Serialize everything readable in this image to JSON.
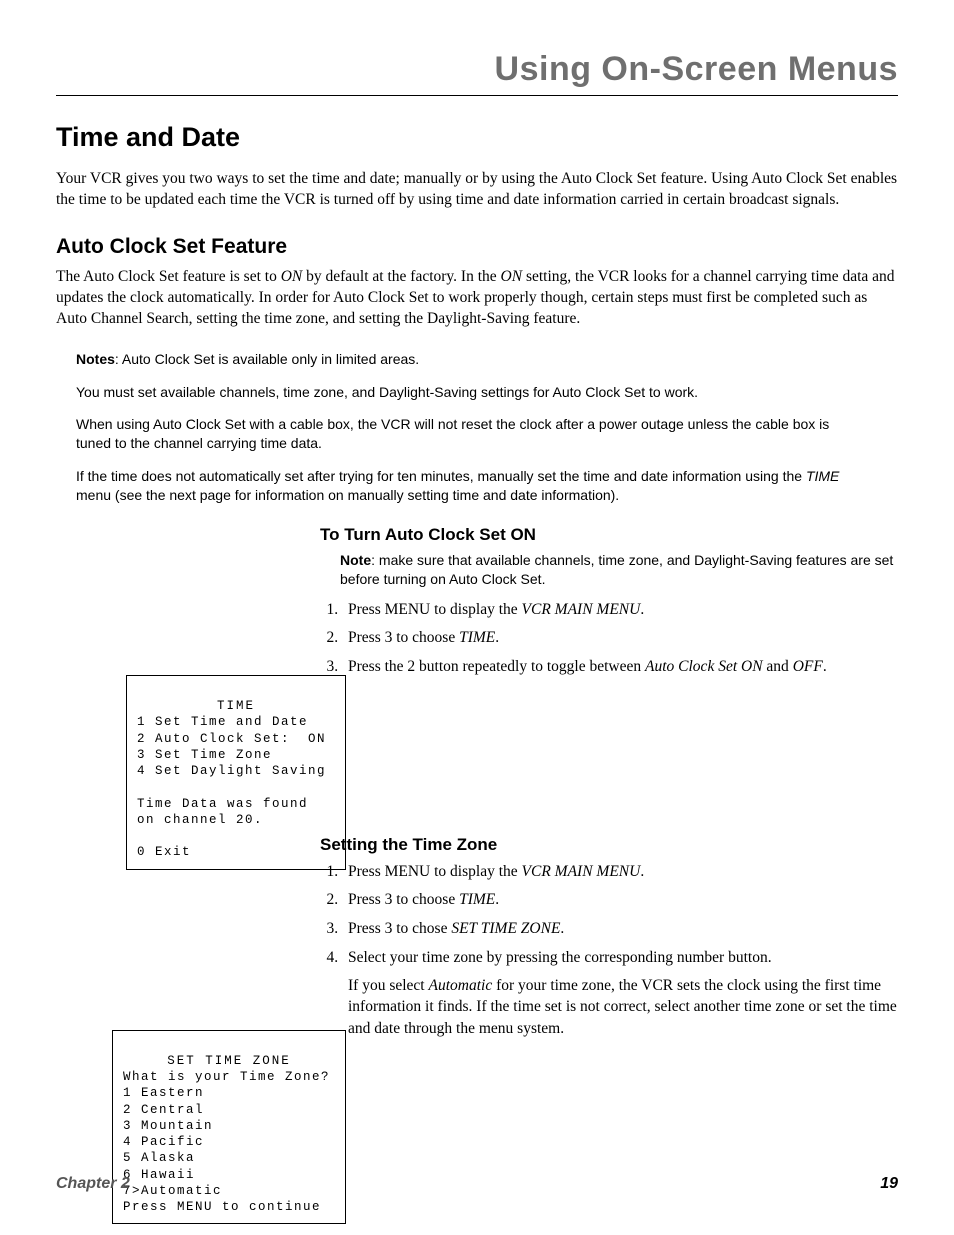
{
  "header": "Using On-Screen Menus",
  "h1": "Time and Date",
  "intro": "Your VCR gives you two ways to set the time and date; manually or by using the Auto Clock Set feature. Using Auto Clock Set enables the time to be updated each time the VCR is turned off by using time and date information carried in certain broadcast signals.",
  "h2": "Auto Clock Set Feature",
  "p_auto_pre": "The Auto Clock Set feature is set to ",
  "p_auto_on1": "ON",
  "p_auto_mid": " by default at the factory. In the ",
  "p_auto_on2": "ON",
  "p_auto_post": " setting, the VCR looks for a channel carrying time data and updates the clock automatically. In order for Auto Clock Set to work properly though, certain steps must first be completed such as Auto Channel Search, setting the time zone, and setting the Daylight-Saving feature.",
  "notes_label": "Notes",
  "note1": ": Auto Clock Set is available only in limited areas.",
  "note2": "You must set available channels, time zone, and Daylight-Saving settings for Auto Clock Set to work.",
  "note3": "When using Auto Clock Set with a cable box, the VCR will not reset the clock after a power outage unless the cable box is tuned to the channel carrying time data.",
  "note4a": "If the time does not automatically set after trying for ten minutes, manually set the time and date information using the ",
  "note4_em": "TIME",
  "note4b": " menu (see the next page for information on manually setting time and date information).",
  "section_on": {
    "title": "To Turn Auto Clock Set ON",
    "note_label": "Note",
    "note_text": ": make sure that available channels, time zone, and Daylight-Saving features are set before turning on Auto Clock Set.",
    "s1a": "Press MENU to display the ",
    "s1em": "VCR MAIN MENU",
    "s1b": ".",
    "s2a": "Press 3 to choose ",
    "s2em": "TIME",
    "s2b": ".",
    "s3a": "Press the 2 button repeatedly to toggle between ",
    "s3em1": "Auto Clock Set ON",
    "s3mid": " and ",
    "s3em2": "OFF",
    "s3b": "."
  },
  "section_tz": {
    "title": "Setting the Time Zone",
    "s1a": "Press MENU to display the ",
    "s1em": "VCR MAIN MENU",
    "s1b": ".",
    "s2a": "Press 3 to choose ",
    "s2em": "TIME",
    "s2b": ".",
    "s3a": "Press 3 to chose ",
    "s3em": "SET TIME ZONE",
    "s3b": ".",
    "s4": "Select your time zone by pressing the corresponding number button.",
    "sub_a": "If you select ",
    "sub_em": "Automatic",
    "sub_b": " for your time zone, the VCR sets the clock using the first time information it finds. If the time set is not correct, select another time zone or set the time and date through the menu system."
  },
  "menu1": {
    "title": "TIME",
    "l1": "1 Set Time and Date",
    "l2": "2 Auto Clock Set:  ON",
    "l3": "3 Set Time Zone",
    "l4": "4 Set Daylight Saving",
    "l5": "Time Data was found",
    "l6": "on channel 20.",
    "l7": "0 Exit"
  },
  "menu2": {
    "title": "SET TIME ZONE",
    "l1": "What is your Time Zone?",
    "l2": "1 Eastern",
    "l3": "2 Central",
    "l4": "3 Mountain",
    "l5": "4 Pacific",
    "l6": "5 Alaska",
    "l7": "6 Hawaii",
    "l8": "7>Automatic",
    "l9": "Press MENU to continue"
  },
  "footer_chapter": "Chapter 2",
  "footer_page": "19"
}
